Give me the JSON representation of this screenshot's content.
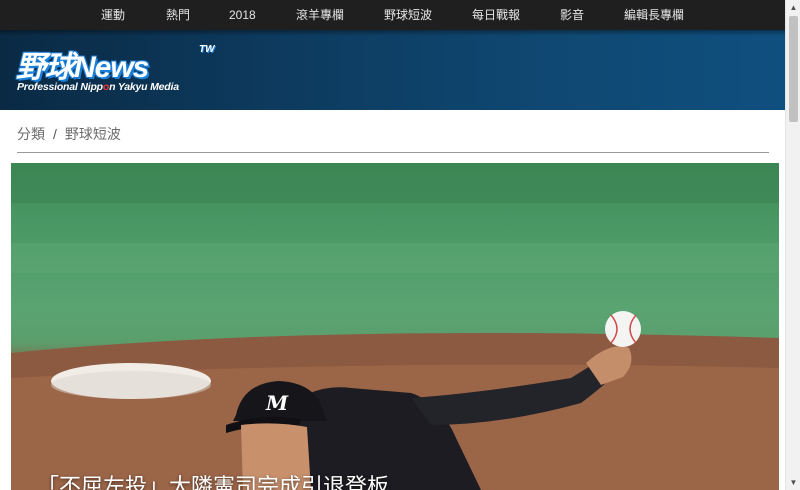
{
  "nav": {
    "items": [
      {
        "label": "運動"
      },
      {
        "label": "熱門"
      },
      {
        "label": "2018"
      },
      {
        "label": "滾羊專欄"
      },
      {
        "label": "野球短波"
      },
      {
        "label": "每日戰報"
      },
      {
        "label": "影音"
      },
      {
        "label": "編輯長專欄"
      }
    ]
  },
  "logo": {
    "main": "野球News",
    "tw": "TW",
    "sub_pre": "Professional Nipp",
    "sub_o": "o",
    "sub_post": "n Yakyu Media"
  },
  "breadcrumb": {
    "parent": "分類",
    "separator": "/",
    "current": "野球短波"
  },
  "hero": {
    "title": "「不屈左投」大隣憲司完成引退登板",
    "jersey_letter": "M"
  },
  "colors": {
    "nav_bg": "#1f1f1f",
    "banner_bg": "#0d3a5e",
    "logo_accent": "#1b7fd8",
    "logo_o": "#e53935"
  },
  "icons": {
    "scroll_up": "▲",
    "scroll_down": "▼"
  }
}
